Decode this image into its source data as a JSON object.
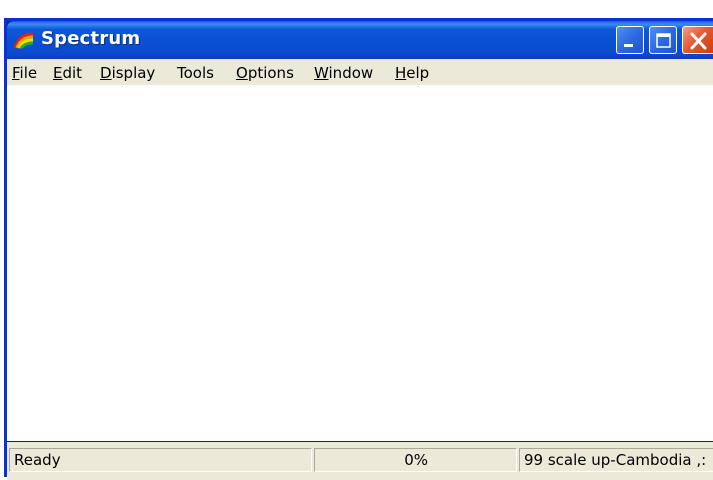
{
  "window": {
    "title": "Spectrum"
  },
  "menu": {
    "file": {
      "mn": "F",
      "rest": "ile"
    },
    "edit": {
      "mn": "E",
      "rest": "dit"
    },
    "display": {
      "mn": "D",
      "rest": "isplay"
    },
    "tools": {
      "label": "Tools"
    },
    "options": {
      "mn": "O",
      "rest": "ptions"
    },
    "window": {
      "mn": "W",
      "rest": "indow"
    },
    "help": {
      "mn": "H",
      "rest": "elp"
    }
  },
  "status": {
    "ready": "Ready",
    "progress": "0%",
    "info": "99 scale up-Cambodia ,:"
  },
  "icons": {
    "app": "rainbow-icon",
    "minimize": "minimize-icon",
    "maximize": "maximize-icon",
    "close": "close-icon"
  },
  "colors": {
    "titlebar": "#0a4fd0",
    "close_button": "#e25a2f",
    "menubar": "#ece9d8",
    "client": "#ffffff"
  }
}
